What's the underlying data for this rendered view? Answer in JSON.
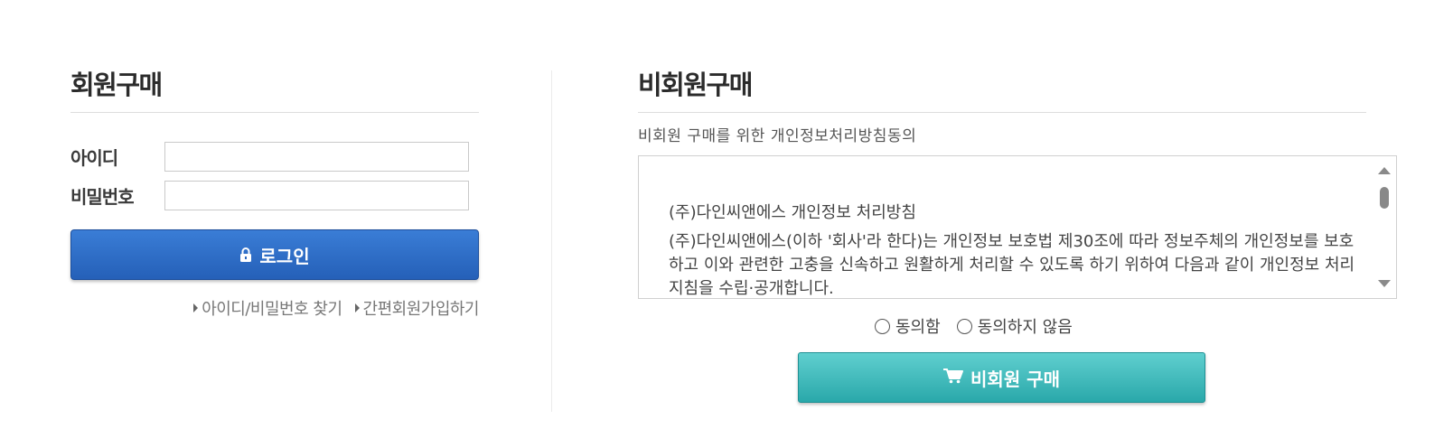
{
  "member": {
    "title": "회원구매",
    "id_label": "아이디",
    "id_value": "",
    "password_label": "비밀번호",
    "password_value": "",
    "login_label": "로그인",
    "find_link": "아이디/비밀번호 찾기",
    "signup_link": "간편회원가입하기"
  },
  "guest": {
    "title": "비회원구매",
    "subtitle": "비회원 구매를 위한 개인정보처리방침동의",
    "terms": {
      "heading": "(주)다인씨앤에스 개인정보 처리방침",
      "body": "(주)다인씨앤에스(이하 '회사'라 한다)는 개인정보 보호법 제30조에 따라 정보주체의 개인정보를 보호하고 이와 관련한 고충을 신속하고 원활하게 처리할 수 있도록 하기 위하여 다음과 같이 개인정보 처리지침을 수립·공개합니다."
    },
    "agree_label": "동의함",
    "disagree_label": "동의하지 않음",
    "purchase_label": "비회원 구매"
  },
  "colors": {
    "login_button": "#2f6fc9",
    "guest_button": "#3dbbbd"
  },
  "icons": {
    "login": "lock-icon",
    "purchase": "cart-icon",
    "links": "arrow-right-icon"
  }
}
